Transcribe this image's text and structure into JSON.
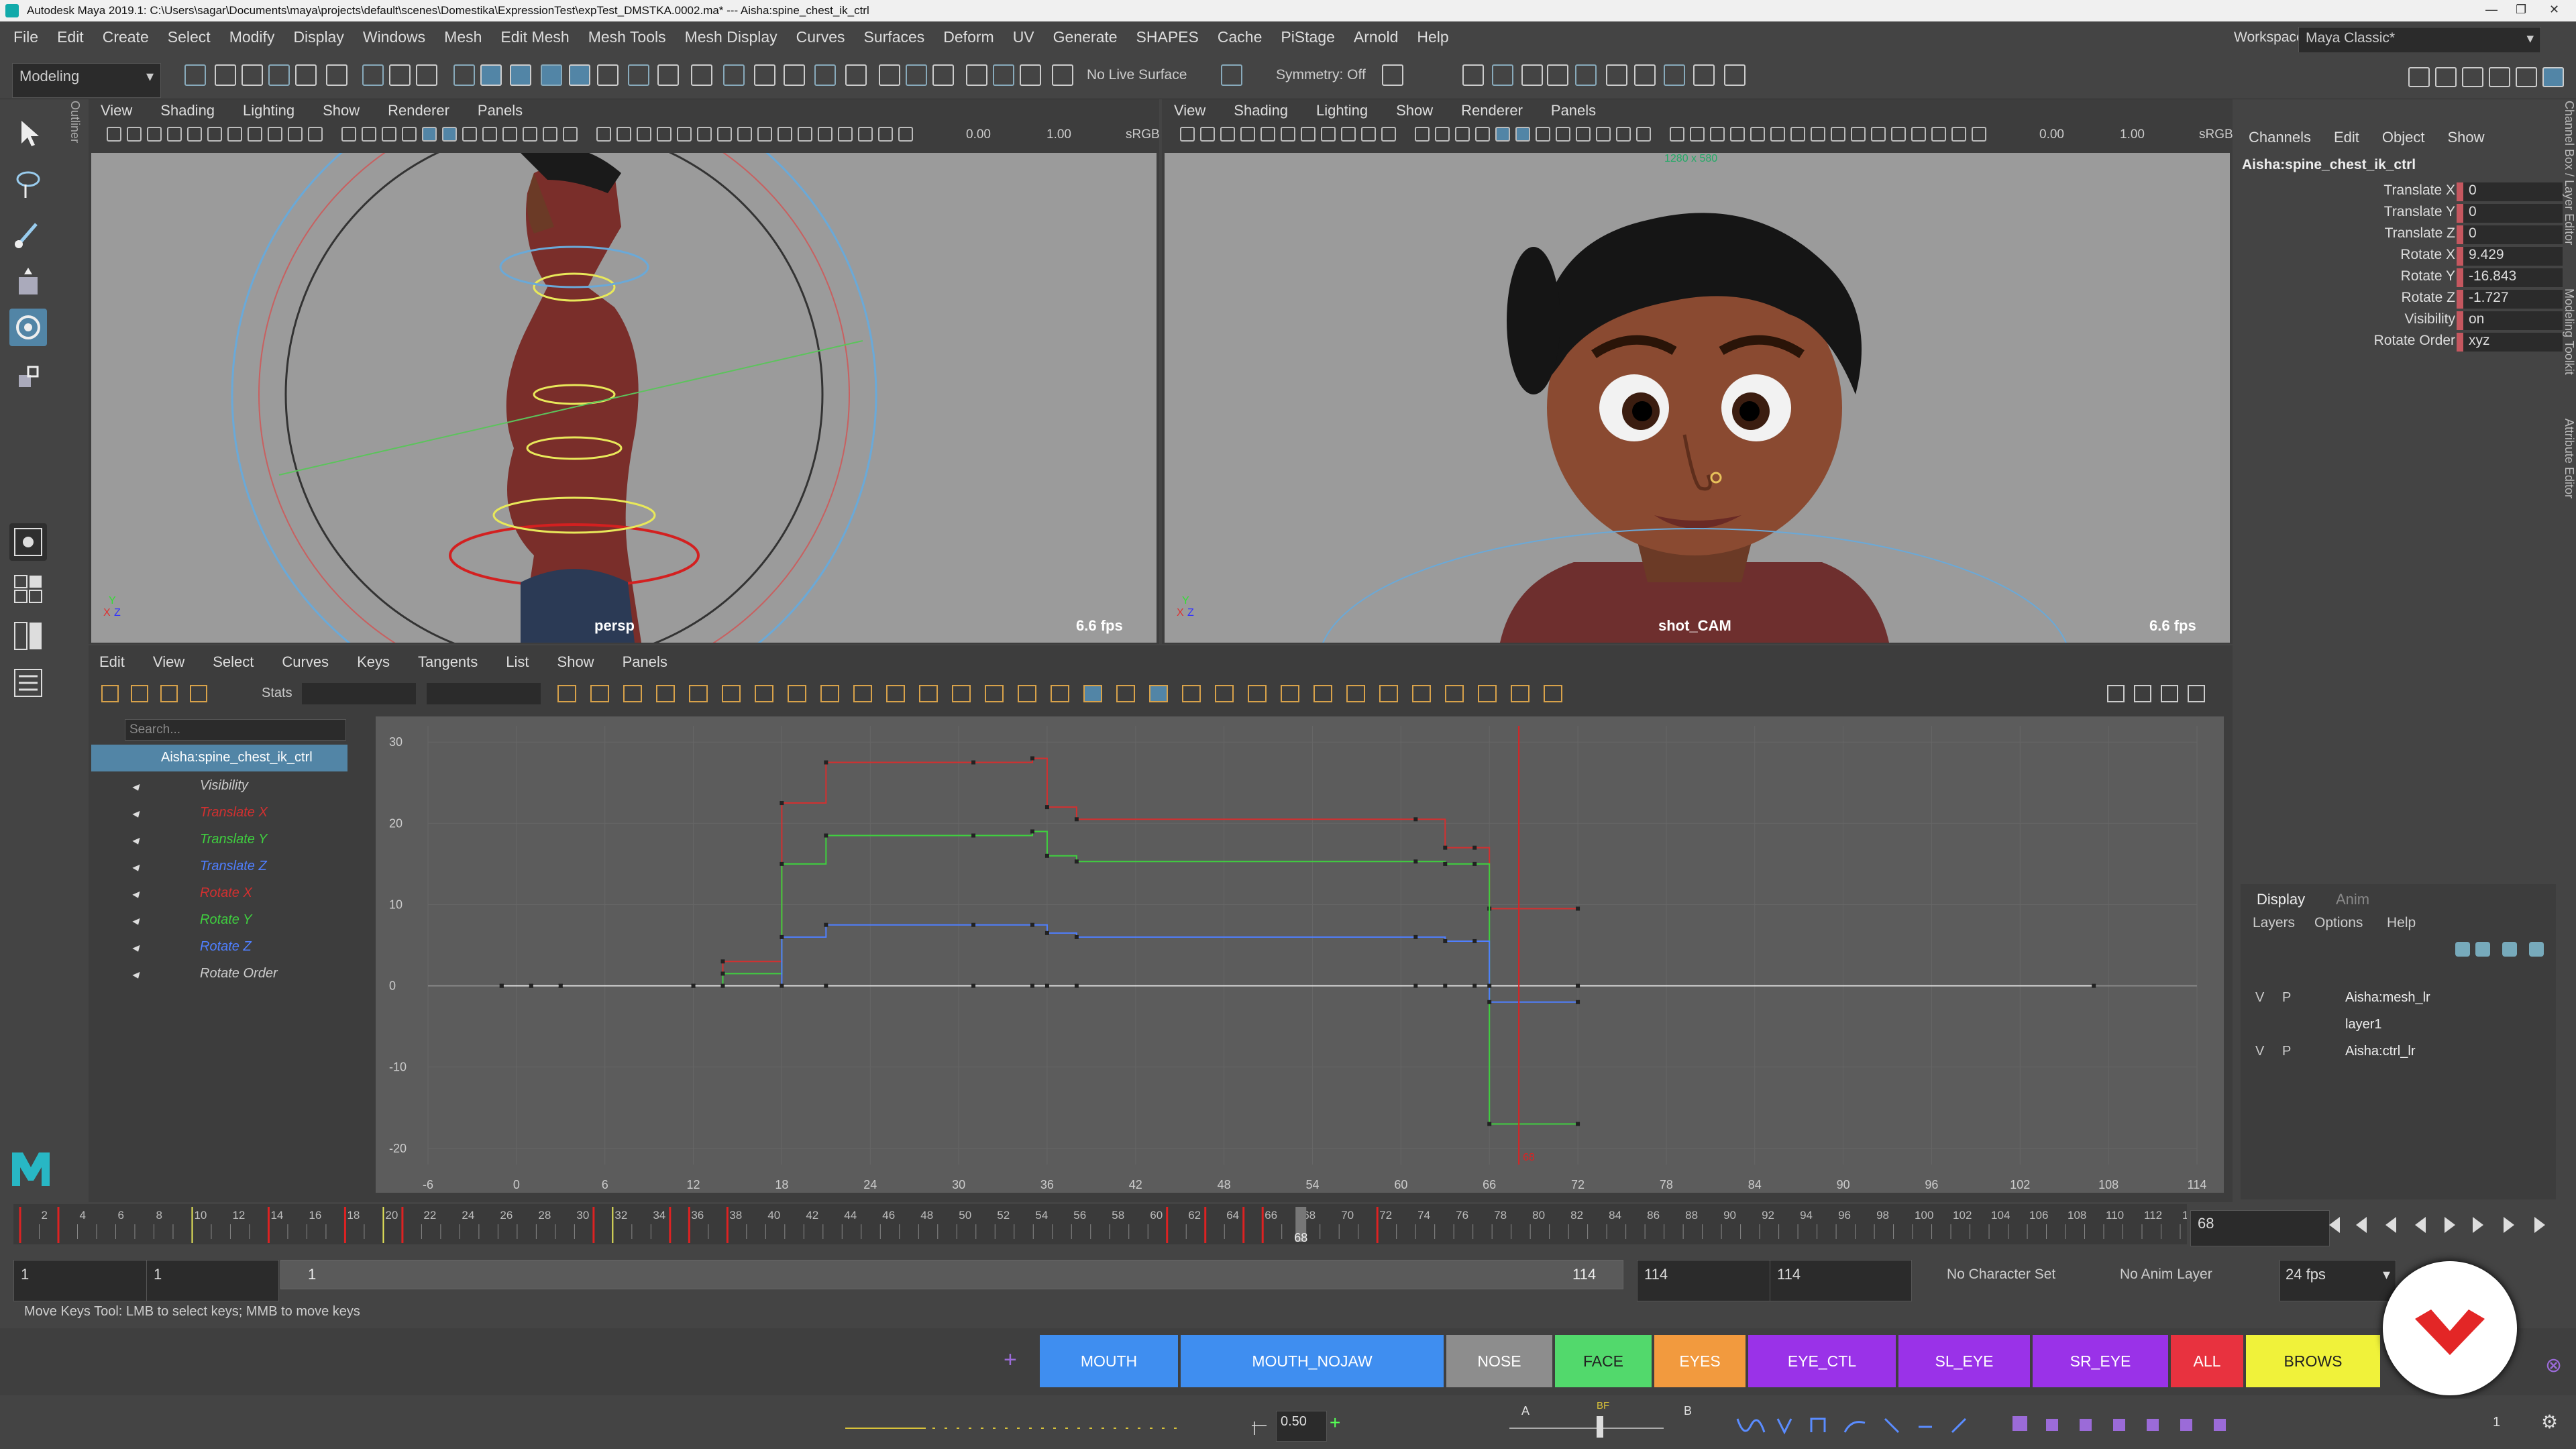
{
  "titlebar": {
    "title": "Autodesk Maya 2019.1: C:\\Users\\sagar\\Documents\\maya\\projects\\default\\scenes\\Domestika\\ExpressionTest\\expTest_DMSTKA.0002.ma*  ---  Aisha:spine_chest_ik_ctrl",
    "minimize": "—",
    "maximize": "❐",
    "close": "✕"
  },
  "menubar": {
    "items": [
      "File",
      "Edit",
      "Create",
      "Select",
      "Modify",
      "Display",
      "Windows",
      "Mesh",
      "Edit Mesh",
      "Mesh Tools",
      "Mesh Display",
      "Curves",
      "Surfaces",
      "Deform",
      "UV",
      "Generate",
      "SHAPES",
      "Cache",
      "PiStage",
      "Arnold",
      "Help"
    ],
    "workspace_label": "Workspace :",
    "workspace_value": "Maya Classic*"
  },
  "statusline": {
    "mode": "Modeling",
    "live_surface": "No Live Surface",
    "symmetry": "Symmetry: Off"
  },
  "viewport_left": {
    "menus": [
      "View",
      "Shading",
      "Lighting",
      "Show",
      "Renderer",
      "Panels"
    ],
    "field_a": "0.00",
    "field_b": "1.00",
    "colorspace": "sRGB",
    "camera": "persp",
    "fps": "6.6 fps"
  },
  "viewport_right": {
    "menus": [
      "View",
      "Shading",
      "Lighting",
      "Show",
      "Renderer",
      "Panels"
    ],
    "field_a": "0.00",
    "field_b": "1.00",
    "colorspace": "sRGB",
    "camera": "shot_CAM",
    "fps": "6.6 fps",
    "resolution": "1280 x 580"
  },
  "channelbox": {
    "tabs": [
      "Channels",
      "Edit",
      "Object",
      "Show"
    ],
    "object": "Aisha:spine_chest_ik_ctrl",
    "channels": [
      {
        "name": "Translate X",
        "value": "0"
      },
      {
        "name": "Translate Y",
        "value": "0"
      },
      {
        "name": "Translate Z",
        "value": "0"
      },
      {
        "name": "Rotate X",
        "value": "9.429"
      },
      {
        "name": "Rotate Y",
        "value": "-16.843"
      },
      {
        "name": "Rotate Z",
        "value": "-1.727"
      },
      {
        "name": "Visibility",
        "value": "on"
      },
      {
        "name": "Rotate Order",
        "value": "xyz"
      }
    ],
    "side_tabs": [
      "Channel Box / Layer Editor",
      "Modeling Toolkit",
      "Attribute Editor"
    ]
  },
  "layer_editor": {
    "tabs": [
      "Display",
      "Anim"
    ],
    "menus": [
      "Layers",
      "Options",
      "Help"
    ],
    "layers": [
      {
        "v": "V",
        "p": "P",
        "name": "Aisha:mesh_lr"
      },
      {
        "v": "",
        "p": "",
        "name": "layer1"
      },
      {
        "v": "V",
        "p": "P",
        "name": "Aisha:ctrl_lr"
      }
    ]
  },
  "graph_editor": {
    "menus": [
      "Edit",
      "View",
      "Select",
      "Curves",
      "Keys",
      "Tangents",
      "List",
      "Show",
      "Panels"
    ],
    "stats_label": "Stats",
    "search_placeholder": "Search...",
    "outliner_root": "Aisha:spine_chest_ik_ctrl",
    "attributes": [
      {
        "name": "Visibility",
        "color": "#cccccc"
      },
      {
        "name": "Translate X",
        "color": "#d23030"
      },
      {
        "name": "Translate Y",
        "color": "#3fcf3f"
      },
      {
        "name": "Translate Z",
        "color": "#4f7fff"
      },
      {
        "name": "Rotate X",
        "color": "#d23030"
      },
      {
        "name": "Rotate Y",
        "color": "#3fcf3f"
      },
      {
        "name": "Rotate Z",
        "color": "#4f7fff"
      },
      {
        "name": "Rotate Order",
        "color": "#cccccc"
      }
    ],
    "x_ticks": [
      "-6",
      "0",
      "6",
      "12",
      "18",
      "24",
      "30",
      "36",
      "42",
      "48",
      "54",
      "60",
      "66",
      "72",
      "78",
      "84",
      "90",
      "96",
      "102",
      "108",
      "114"
    ],
    "y_ticks": [
      "30",
      "20",
      "10",
      "0",
      "-10",
      "-20"
    ],
    "current_frame_marker": "68"
  },
  "chart_data": {
    "type": "line",
    "xlabel": "",
    "ylabel": "",
    "xlim": [
      -6,
      114
    ],
    "ylim": [
      -22,
      32
    ],
    "series": [
      {
        "name": "Rotate X",
        "color": "#d23030",
        "x": [
          -1,
          1,
          3,
          12,
          14,
          18,
          21,
          31,
          35,
          36,
          38,
          61,
          63,
          65,
          66,
          72
        ],
        "y": [
          0,
          0,
          0,
          0,
          3,
          22.5,
          27.5,
          27.5,
          28,
          22,
          20.5,
          20.5,
          17,
          17,
          9.5,
          9.5
        ]
      },
      {
        "name": "Rotate Y",
        "color": "#3fcf3f",
        "x": [
          -1,
          1,
          3,
          12,
          14,
          18,
          21,
          31,
          35,
          36,
          38,
          61,
          63,
          65,
          66,
          72
        ],
        "y": [
          0,
          0,
          0,
          0,
          1.5,
          15,
          18.5,
          18.5,
          19,
          16,
          15.3,
          15.3,
          15,
          15,
          -17,
          -17
        ]
      },
      {
        "name": "Rotate Z",
        "color": "#4f7fff",
        "x": [
          -1,
          1,
          3,
          12,
          14,
          18,
          21,
          31,
          35,
          36,
          38,
          61,
          63,
          65,
          66,
          72
        ],
        "y": [
          0,
          0,
          0,
          0,
          0,
          6,
          7.5,
          7.5,
          7.5,
          6.5,
          6,
          6,
          5.5,
          5.5,
          -2,
          -2
        ]
      },
      {
        "name": "Visibility",
        "color": "#dddddd",
        "x": [
          -1,
          1,
          3,
          12,
          14,
          18,
          21,
          31,
          35,
          36,
          38,
          61,
          63,
          65,
          66,
          72,
          107
        ],
        "y": [
          0,
          0,
          0,
          0,
          0,
          0,
          0,
          0,
          0,
          0,
          0,
          0,
          0,
          0,
          0,
          0,
          0
        ]
      }
    ]
  },
  "timeslider": {
    "ticks": [
      "2",
      "4",
      "6",
      "8",
      "10",
      "12",
      "14",
      "16",
      "18",
      "20",
      "22",
      "24",
      "26",
      "28",
      "30",
      "32",
      "34",
      "36",
      "38",
      "40",
      "42",
      "44",
      "46",
      "48",
      "50",
      "52",
      "54",
      "56",
      "58",
      "60",
      "62",
      "64",
      "66",
      "68",
      "70",
      "72",
      "74",
      "76",
      "78",
      "80",
      "82",
      "84",
      "86",
      "88",
      "90",
      "92",
      "94",
      "96",
      "98",
      "100",
      "102",
      "104",
      "106",
      "108",
      "110",
      "112",
      "114"
    ],
    "current_frame": "68"
  },
  "range_slider": {
    "start": "1",
    "anim_start": "1",
    "range_start": "1",
    "range_end": "114",
    "anim_end": "114",
    "end": "114",
    "character_set": "No Character Set",
    "anim_layer": "No Anim Layer",
    "fps": "24 fps"
  },
  "helpline": "Move Keys Tool: LMB to select keys; MMB to move keys",
  "shelf": {
    "add_label": "+",
    "tabs": [
      {
        "label": "MOUTH",
        "color": "#3f8ef0"
      },
      {
        "label": "MOUTH_NOJAW",
        "color": "#3f8ef0"
      },
      {
        "label": "NOSE",
        "color": "#8d8d8d"
      },
      {
        "label": "FACE",
        "color": "#52d96c"
      },
      {
        "label": "EYES",
        "color": "#f29a3e"
      },
      {
        "label": "EYE_CTL",
        "color": "#9a32e8"
      },
      {
        "label": "SL_EYE",
        "color": "#9a32e8"
      },
      {
        "label": "SR_EYE",
        "color": "#9a32e8"
      },
      {
        "label": "ALL",
        "color": "#e8323f"
      },
      {
        "label": "BROWS",
        "color": "#f0f23a"
      }
    ]
  },
  "bottom_toolbar": {
    "weight_value": "0.50",
    "blend_a": "A",
    "blend_bf": "BF",
    "blend_b": "B",
    "page_number": "1"
  }
}
